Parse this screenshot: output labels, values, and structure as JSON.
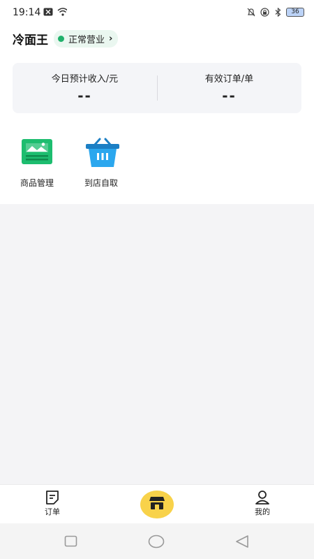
{
  "status_bar": {
    "time": "19:14",
    "battery": "36"
  },
  "header": {
    "shop_name": "冷面王",
    "status_label": "正常营业"
  },
  "stats": {
    "income_label": "今日预计收入/元",
    "income_value": "--",
    "orders_label": "有效订单/单",
    "orders_value": "--"
  },
  "features": [
    {
      "label": "商品管理",
      "icon": "image-icon"
    },
    {
      "label": "到店自取",
      "icon": "basket-icon"
    }
  ],
  "tabbar": {
    "orders_label": "订单",
    "mine_label": "我的"
  },
  "colors": {
    "accent": "#f8d24a",
    "status_green": "#20b16b",
    "feature_green": "#1dbd6f",
    "feature_blue": "#2ba7ee"
  }
}
